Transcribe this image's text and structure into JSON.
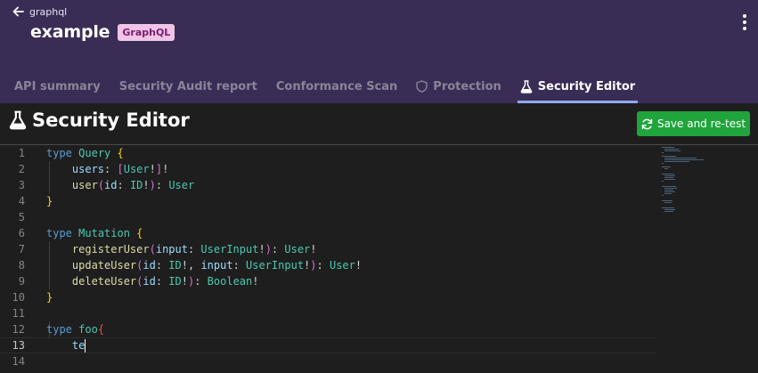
{
  "header": {
    "breadcrumb": "graphql",
    "title": "example",
    "badge": "GraphQL",
    "colors": {
      "background": "#3a2d55",
      "badge_bg": "#f0c4e8",
      "badge_text": "#7a1d6c"
    }
  },
  "tabs": [
    {
      "label": "API summary",
      "active": false,
      "icon": null
    },
    {
      "label": "Security Audit report",
      "active": false,
      "icon": null
    },
    {
      "label": "Conformance Scan",
      "active": false,
      "icon": null
    },
    {
      "label": "Protection",
      "active": false,
      "icon": "shield-icon"
    },
    {
      "label": "Security Editor",
      "active": true,
      "icon": "flask-icon"
    }
  ],
  "editor": {
    "title": "Security Editor",
    "title_icon": "flask-icon",
    "save_label": "Save and re-test",
    "save_icon": "refresh-icon",
    "save_color": "#1fa53c",
    "current_line": 13,
    "lines": [
      "type Query {",
      "    users: [User!]!",
      "    user(id: ID!): User",
      "}",
      "",
      "type Mutation {",
      "    registerUser(input: UserInput!): User!",
      "    updateUser(id: ID!, input: UserInput!): User!",
      "    deleteUser(id: ID!): Boolean!",
      "}",
      "",
      "type foo{",
      "    te",
      "",
      ""
    ]
  }
}
